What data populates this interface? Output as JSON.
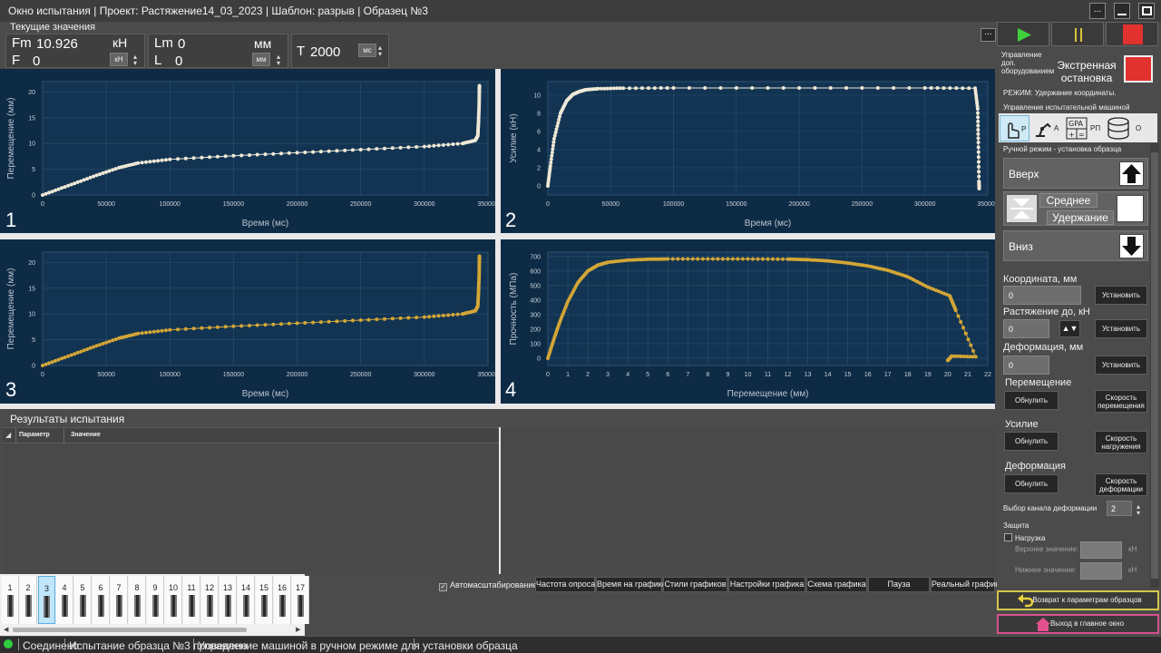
{
  "window": {
    "title": "Окно испытания | Проект: Растяжение14_03_2023 | Шаблон: разрыв | Образец №3",
    "menu_label": "...",
    "more_label": "..."
  },
  "current_values": {
    "label": "Текущие значения",
    "fm_label": "Fm",
    "fm_value": "10.926",
    "fm_unit": "кН",
    "f_label": "F",
    "f_value": "0",
    "f_unit_select": "кН",
    "lm_label": "Lm",
    "lm_value": "0",
    "lm_unit": "мм",
    "l_label": "L",
    "l_value": "0",
    "l_unit_select": "мм",
    "t_label": "T",
    "t_value": "2000",
    "t_unit_select": "мс"
  },
  "charts": [
    {
      "num": "1",
      "ylabel": "Перемещение (мм)",
      "xlabel": "Время (мс)",
      "ylim": [
        0,
        22
      ],
      "yticks": [
        0,
        5,
        10,
        15,
        20
      ],
      "xlim": [
        0,
        350000
      ],
      "xticks": [
        0,
        50000,
        100000,
        150000,
        200000,
        250000,
        300000,
        350000
      ],
      "color": "#efe8d6"
    },
    {
      "num": "2",
      "ylabel": "Усилие (кН)",
      "xlabel": "Время (мс)",
      "ylim": [
        -1,
        11.5
      ],
      "yticks": [
        0,
        2,
        4,
        6,
        8,
        10
      ],
      "xlim": [
        0,
        350000
      ],
      "xticks": [
        0,
        50000,
        100000,
        150000,
        200000,
        250000,
        300000,
        350000
      ],
      "color": "#efe8d6"
    },
    {
      "num": "3",
      "ylabel": "Перемещение (мм)",
      "xlabel": "Время (мс)",
      "ylim": [
        0,
        22
      ],
      "yticks": [
        0,
        5,
        10,
        15,
        20
      ],
      "xlim": [
        0,
        350000
      ],
      "xticks": [
        0,
        50000,
        100000,
        150000,
        200000,
        250000,
        300000,
        350000
      ],
      "color": "#d4a636"
    },
    {
      "num": "4",
      "ylabel": "Прочность (МПа)",
      "xlabel": "Перемещение (мм)",
      "ylim": [
        -50,
        730
      ],
      "yticks": [
        0,
        100,
        200,
        300,
        400,
        500,
        600,
        700
      ],
      "xlim": [
        0,
        22
      ],
      "xticks": [
        0,
        1,
        2,
        3,
        4,
        5,
        6,
        7,
        8,
        9,
        10,
        11,
        12,
        13,
        14,
        15,
        16,
        17,
        18,
        19,
        20,
        21,
        22
      ],
      "color": "#d4a636"
    }
  ],
  "chart_data": [
    {
      "type": "scatter",
      "title": "",
      "xlabel": "Время (мс)",
      "ylabel": "Перемещение (мм)",
      "xlim": [
        0,
        350000
      ],
      "ylim": [
        0,
        22
      ],
      "x": [
        0,
        20000,
        40000,
        60000,
        75000,
        100000,
        150000,
        200000,
        250000,
        300000,
        330000,
        340000,
        342000,
        342500,
        343000,
        343200,
        343300
      ],
      "y": [
        0,
        1.8,
        3.6,
        5.3,
        6.2,
        6.9,
        7.6,
        8.2,
        8.8,
        9.4,
        10.0,
        10.6,
        11.5,
        14,
        17,
        20,
        21.2
      ]
    },
    {
      "type": "scatter",
      "title": "",
      "xlabel": "Время (мс)",
      "ylabel": "Усилие (кН)",
      "xlim": [
        0,
        350000
      ],
      "ylim": [
        -1,
        11.5
      ],
      "x": [
        0,
        2000,
        5000,
        10000,
        15000,
        20000,
        25000,
        30000,
        40000,
        60000,
        100000,
        200000,
        300000,
        340000,
        342000,
        342500,
        343000,
        343200
      ],
      "y": [
        0,
        2.2,
        5.2,
        8.0,
        9.4,
        10.1,
        10.4,
        10.6,
        10.72,
        10.78,
        10.8,
        10.8,
        10.8,
        10.78,
        8.5,
        4.8,
        0.5,
        -0.3
      ]
    },
    {
      "type": "scatter",
      "title": "",
      "xlabel": "Время (мс)",
      "ylabel": "Перемещение (мм)",
      "xlim": [
        0,
        350000
      ],
      "ylim": [
        0,
        22
      ],
      "x": [
        0,
        20000,
        40000,
        60000,
        75000,
        100000,
        150000,
        200000,
        250000,
        300000,
        330000,
        340000,
        342000,
        342500,
        343000,
        343200,
        343300
      ],
      "y": [
        0,
        1.8,
        3.6,
        5.3,
        6.2,
        6.9,
        7.6,
        8.2,
        8.8,
        9.4,
        10.0,
        10.6,
        11.5,
        14,
        17,
        20,
        21.2
      ]
    },
    {
      "type": "scatter",
      "title": "",
      "xlabel": "Перемещение (мм)",
      "ylabel": "Прочность (МПа)",
      "xlim": [
        0,
        22
      ],
      "ylim": [
        -50,
        730
      ],
      "x": [
        0,
        0.3,
        0.6,
        1.0,
        1.5,
        2.0,
        2.5,
        3.0,
        4.0,
        5.0,
        6.0,
        8.0,
        10.0,
        12.0,
        13.0,
        14.0,
        15.0,
        16.0,
        17.0,
        18.0,
        19.0,
        20.1,
        20.4,
        21.4,
        20.2,
        20.0
      ],
      "y": [
        0,
        130,
        250,
        390,
        520,
        600,
        640,
        660,
        675,
        681,
        683,
        683,
        683,
        682,
        678,
        670,
        655,
        635,
        605,
        560,
        490,
        430,
        330,
        10,
        15,
        -15
      ]
    }
  ],
  "results": {
    "label": "Результаты испытания",
    "col_param": "Параметр",
    "col_value": "Значение"
  },
  "samples": [
    "1",
    "2",
    "3",
    "4",
    "5",
    "6",
    "7",
    "8",
    "9",
    "10",
    "11",
    "12",
    "13",
    "14",
    "15",
    "16",
    "17"
  ],
  "selected_sample": "3",
  "bottom_toolbar": {
    "autoscale": "Автомасштабирование",
    "freq": "Частота опроса",
    "time": "Время на графике",
    "styles": "Стили графиков",
    "settings": "Настройки графика",
    "scheme": "Схема графика",
    "pause": "Пауза",
    "real": "Реальный график"
  },
  "status": {
    "connected": "Соединено",
    "test": "Испытание образца №3 проведено",
    "mode": "Управление машиной в ручном режиме для установки образца"
  },
  "right_panel": {
    "extra_equipment": "Управление доп. оборудованием",
    "estop": "Экстренная остановка",
    "mode_line": "РЕЖИМ: Удержание координаты.",
    "machine_control": "Управление испытательной машиной",
    "tabs": [
      "P",
      "A",
      "РП",
      "О"
    ],
    "manual_mode": "Ручной режим - установка образца",
    "up": "Вверх",
    "middle": "Среднее",
    "hold": "Удержание",
    "down": "Вниз",
    "coord_label": "Координата, мм",
    "coord_value": "0",
    "set_btn": "Установить",
    "stretch_label": "Растяжение до, кН",
    "stretch_value": "0",
    "deform_label": "Деформация, мм",
    "deform_value": "0",
    "move_label": "Перемещение",
    "reset_btn": "Обнулить",
    "move_speed": "Скорость перемещения",
    "force_label": "Усилие",
    "load_speed": "Скорость нагружения",
    "def_section": "Деформация",
    "def_speed": "Скорость деформации",
    "channel_label": "Выбор канала деформации",
    "channel_value": "2",
    "protection": "Защита",
    "load_cb": "Нагрузка",
    "upper": "Верхнее значение:",
    "lower": "Нижнее значение:",
    "unit_kn": "кН",
    "back": "Возврат к параметрам образцов",
    "exit": "Выход в главное окно"
  }
}
